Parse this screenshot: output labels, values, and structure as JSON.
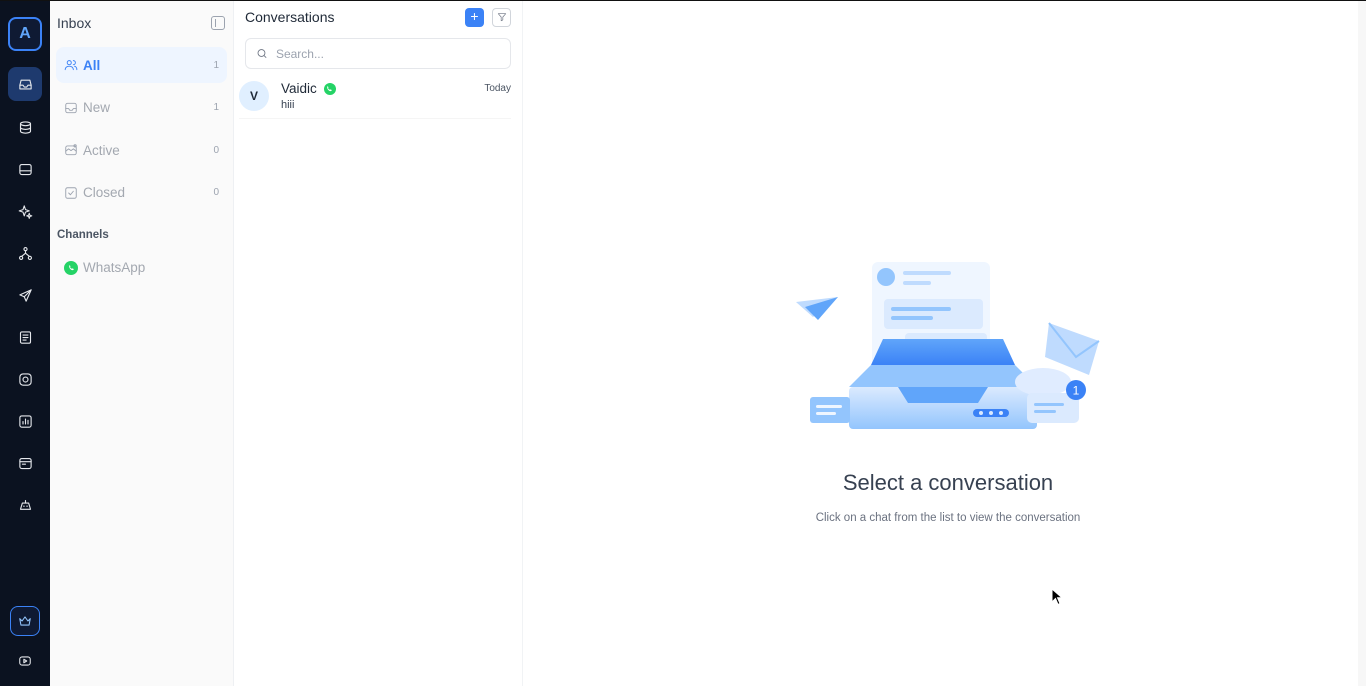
{
  "rail": {
    "logo_letter": "A",
    "items": [
      {
        "name": "inbox-icon",
        "active": true
      },
      {
        "name": "database-icon",
        "active": false
      },
      {
        "name": "hard-drive-icon",
        "active": false
      },
      {
        "name": "sparkle-icon",
        "active": false
      },
      {
        "name": "flow-icon",
        "active": false
      },
      {
        "name": "send-icon",
        "active": false
      },
      {
        "name": "list-icon",
        "active": false
      },
      {
        "name": "instagram-icon",
        "active": false
      },
      {
        "name": "chart-icon",
        "active": false
      },
      {
        "name": "layout-icon",
        "active": false
      },
      {
        "name": "ai-bot-icon",
        "active": false
      }
    ],
    "bottom": [
      "crown-icon",
      "youtube-icon"
    ]
  },
  "inbox": {
    "title": "Inbox",
    "items": [
      {
        "label": "All",
        "count": "1"
      },
      {
        "label": "New",
        "count": "1"
      },
      {
        "label": "Active",
        "count": "0"
      },
      {
        "label": "Closed",
        "count": "0"
      }
    ],
    "channels_title": "Channels",
    "channels": [
      {
        "label": "WhatsApp"
      }
    ]
  },
  "conversations": {
    "title": "Conversations",
    "add_label": "+",
    "search_placeholder": "Search...",
    "items": [
      {
        "initial": "V",
        "name": "Vaidic",
        "preview": "hiii",
        "time": "Today"
      }
    ]
  },
  "empty_state": {
    "badge_count": "1",
    "title": "Select a conversation",
    "subtitle": "Click on a chat from the list to view the conversation"
  },
  "colors": {
    "accent": "#3b82f6",
    "rail_bg": "#0b1220",
    "whatsapp": "#25d366"
  }
}
